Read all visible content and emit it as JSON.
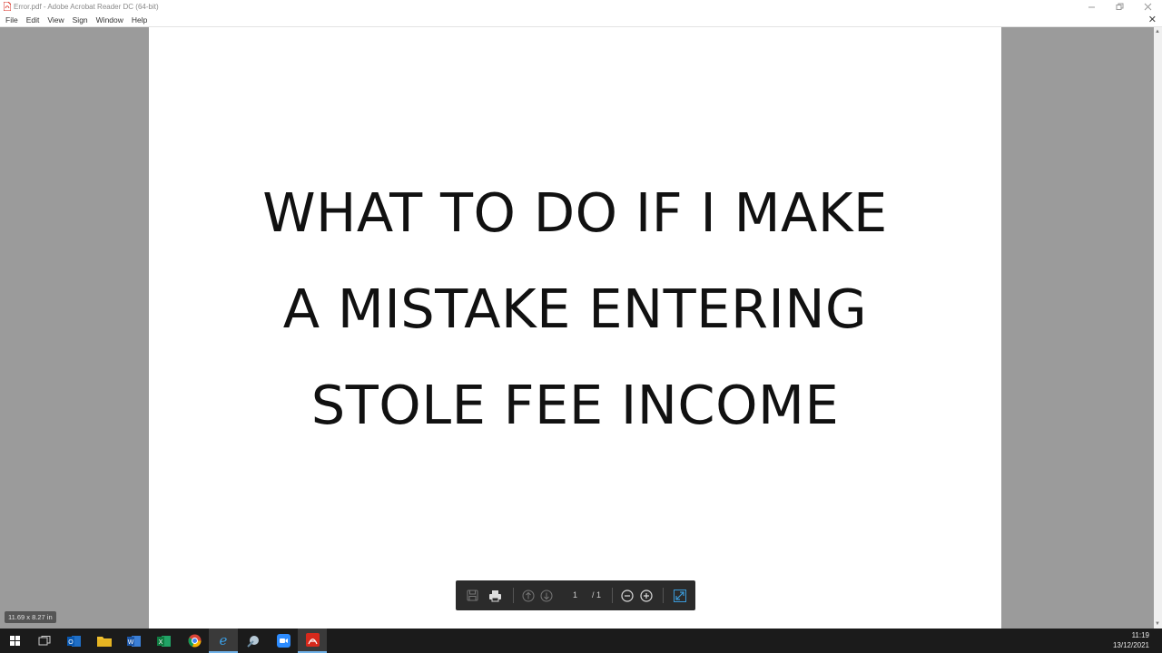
{
  "window": {
    "title": "Error.pdf - Adobe Acrobat Reader DC (64-bit)",
    "controls": [
      "minimize",
      "restore",
      "close"
    ]
  },
  "menu": {
    "items": [
      "File",
      "Edit",
      "View",
      "Sign",
      "Window",
      "Help"
    ],
    "close_doc": "✕"
  },
  "document": {
    "lines": [
      "WHAT TO DO IF I MAKE",
      "A MISTAKE ENTERING",
      "STOLE FEE INCOME"
    ]
  },
  "toolbar": {
    "current_page": "1",
    "total_pages": "/ 1"
  },
  "page_size": "11.69 x 8.27 in",
  "taskbar": {
    "apps": [
      "start-menu",
      "task-view",
      "outlook",
      "file-explorer",
      "word",
      "excel",
      "chrome",
      "internet-explorer",
      "citrix-receiver",
      "zoom",
      "acrobat-reader"
    ],
    "time": "11:19",
    "date": "13/12/2021"
  },
  "colors": {
    "acrobat_red": "#d7291c",
    "taskbar": "#1b1b1b",
    "toolbar": "#2b2b2b",
    "fit_button": "#3a9ad9"
  }
}
